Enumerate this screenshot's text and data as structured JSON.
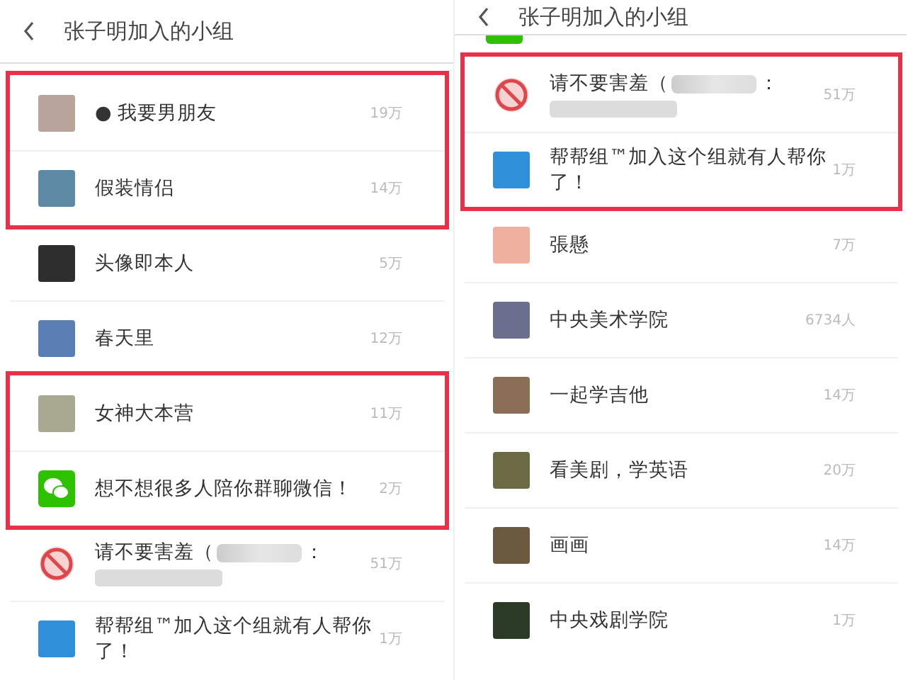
{
  "panels": [
    {
      "title": "张子明加入的小组",
      "groups": [
        {
          "highlighted": true,
          "rows": [
            {
              "kind": "photo",
              "color": "#b9a49c",
              "title": "● 我要男朋友",
              "count": "19万"
            },
            {
              "kind": "photo",
              "color": "#5f8aa6",
              "title": "假装情侣",
              "count": "14万"
            }
          ]
        },
        {
          "highlighted": false,
          "rows": [
            {
              "kind": "photo",
              "color": "#2e2e2e",
              "title": "头像即本人",
              "count": "5万"
            },
            {
              "kind": "photo",
              "color": "#5a7fb5",
              "title": "春天里",
              "count": "12万"
            }
          ]
        },
        {
          "highlighted": true,
          "rows": [
            {
              "kind": "photo",
              "color": "#a8a890",
              "title": "女神大本营",
              "count": "11万"
            },
            {
              "kind": "wechat",
              "color": "#2dc100",
              "title": "想不想很多人陪你群聊微信！",
              "count": "2万"
            }
          ]
        },
        {
          "highlighted": false,
          "rows": [
            {
              "kind": "prohibit",
              "color": "#e0454a",
              "title": "请不要害羞（",
              "redacted": true,
              "title_end": "：",
              "count": "51万"
            },
            {
              "kind": "photo",
              "color": "#2f8fd8",
              "title": "帮帮组™加入这个组就有人帮你了！",
              "count": "1万"
            }
          ]
        }
      ]
    },
    {
      "title": "张子明加入的小组",
      "cut_row": {
        "kind": "wechat",
        "color": "#2dc100"
      },
      "groups": [
        {
          "highlighted": true,
          "rows": [
            {
              "kind": "prohibit",
              "color": "#e0454a",
              "title": "请不要害羞（",
              "redacted": true,
              "title_end": "：",
              "count": "51万"
            },
            {
              "kind": "photo",
              "color": "#2f8fd8",
              "title": "帮帮组™加入这个组就有人帮你了！",
              "count": "1万"
            }
          ]
        },
        {
          "highlighted": false,
          "rows": [
            {
              "kind": "photo",
              "color": "#f0b0a0",
              "title": "張懸",
              "count": "7万"
            },
            {
              "kind": "photo",
              "color": "#6a6f8e",
              "title": "中央美术学院",
              "count": "6734人"
            },
            {
              "kind": "photo",
              "color": "#8a6e55",
              "title": "一起学吉他",
              "count": "14万"
            },
            {
              "kind": "photo",
              "color": "#6b6a45",
              "title": "看美剧，学英语",
              "count": "20万"
            },
            {
              "kind": "photo",
              "color": "#6b5a40",
              "title": "画画",
              "count": "14万"
            },
            {
              "kind": "photo",
              "color": "#2a3a25",
              "title": "中央戏剧学院",
              "count": "1万"
            }
          ]
        }
      ]
    }
  ]
}
